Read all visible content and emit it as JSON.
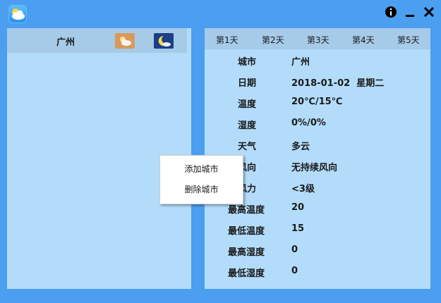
{
  "titlebar": {
    "app_icon": "weather-app-icon",
    "buttons": [
      {
        "name": "info-button",
        "icon": "info-icon"
      },
      {
        "name": "minimize-button",
        "icon": "minimize-icon"
      },
      {
        "name": "close-button",
        "icon": "close-icon"
      }
    ]
  },
  "left": {
    "city": "广州",
    "icons": [
      "partly-cloudy-day-icon",
      "cloudy-night-icon"
    ],
    "colors": {
      "day_icon_bg": "#d89a5c",
      "night_icon_bg": "#1d3f86"
    }
  },
  "tabs": [
    "第1天",
    "第2天",
    "第3天",
    "第4天",
    "第5天"
  ],
  "details": [
    {
      "label": "城市",
      "value": "广州"
    },
    {
      "label": "日期",
      "value": "2018-01-02  星期二"
    },
    {
      "label": "温度",
      "value": "20℃/15℃"
    },
    {
      "label": "湿度",
      "value": "0%/0%"
    },
    {
      "label": "天气",
      "value": "多云"
    },
    {
      "label": "风向",
      "value": "无持续风向"
    },
    {
      "label": "风力",
      "value": "<3级"
    },
    {
      "label": "最高温度",
      "value": "20"
    },
    {
      "label": "最低温度",
      "value": "15"
    },
    {
      "label": "最高湿度",
      "value": "0"
    },
    {
      "label": "最低湿度",
      "value": "0"
    }
  ],
  "context_menu": {
    "items": [
      "添加城市",
      "删除城市"
    ]
  },
  "colors": {
    "background": "#4b9ef0",
    "panel": "#b3dcfb",
    "header_strip": "#a6cbe9"
  }
}
